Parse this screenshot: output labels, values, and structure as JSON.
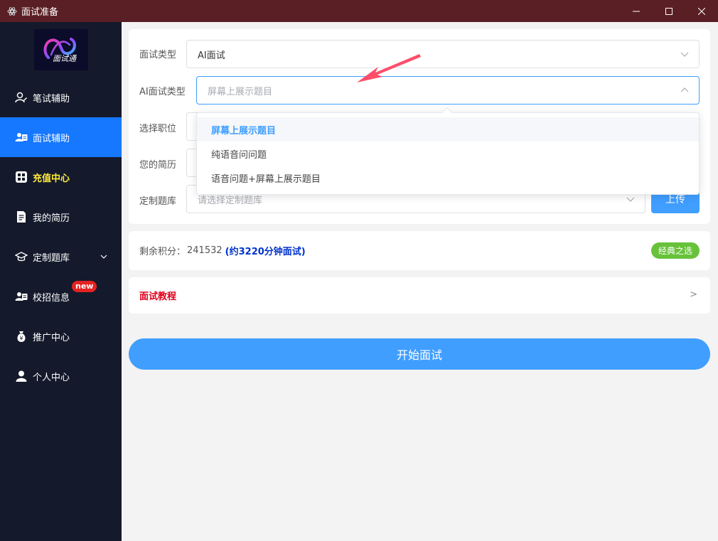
{
  "window": {
    "title": "面试准备"
  },
  "logo": {
    "text": "面试通"
  },
  "sidebar": {
    "items": [
      {
        "label": "笔试辅助",
        "icon": "pen-user-icon"
      },
      {
        "label": "面试辅助",
        "icon": "user-card-icon",
        "active": true
      },
      {
        "label": "充值中心",
        "icon": "grid-icon",
        "highlight": true
      },
      {
        "label": "我的简历",
        "icon": "document-icon"
      },
      {
        "label": "定制题库",
        "icon": "graduation-cap-icon",
        "expandable": true
      },
      {
        "label": "校招信息",
        "icon": "user-card-icon",
        "badge": "new"
      },
      {
        "label": "推广中心",
        "icon": "money-bag-icon"
      },
      {
        "label": "个人中心",
        "icon": "person-icon"
      }
    ]
  },
  "form": {
    "interview_type": {
      "label": "面试类型",
      "value": "AI面试"
    },
    "ai_interview_type": {
      "label": "AI面试类型",
      "placeholder": "屏幕上展示题目"
    },
    "position": {
      "label": "选择职位"
    },
    "resume": {
      "label": "您的简历"
    },
    "question_bank": {
      "label": "定制题库",
      "placeholder": "请选择定制题库"
    },
    "upload_label": "上传"
  },
  "dropdown": {
    "options": [
      "屏幕上展示题目",
      "纯语音问问题",
      "语音问题+屏幕上展示题目"
    ],
    "selected_index": 0
  },
  "score": {
    "label": "剩余积分：",
    "value": "241532",
    "note": "(约3220分钟面试)",
    "badge": "经典之选"
  },
  "tutorial": {
    "label": "面试教程",
    "arrow": ">"
  },
  "start_button": "开始面试",
  "colors": {
    "titlebar": "#5a1f24",
    "sidebar": "#141a2b",
    "active": "#1677ff",
    "primary": "#409eff",
    "highlight_text": "#ffeb3b",
    "badge_green": "#67c23a",
    "tutorial_red": "#e0001b",
    "annotation_arrow": "#ff4d6a"
  }
}
